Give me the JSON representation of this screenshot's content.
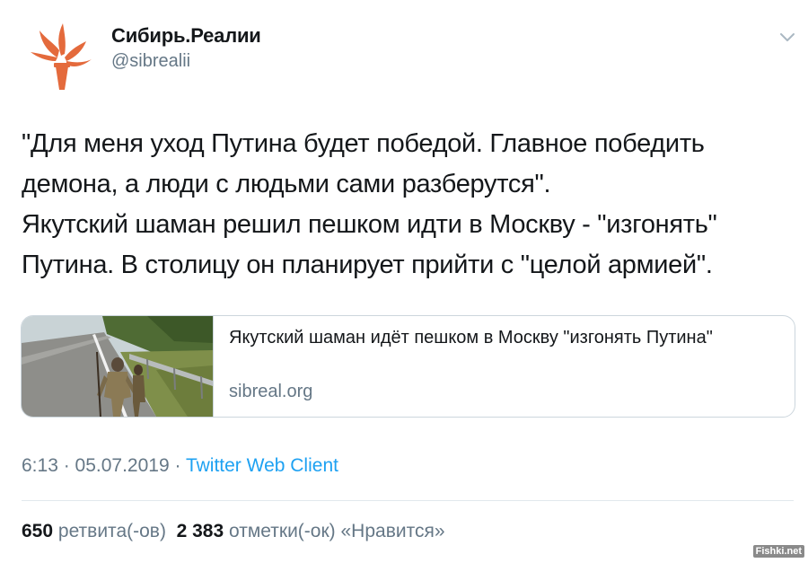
{
  "account": {
    "name": "Сибирь.Реалии",
    "handle": "@sibrealii",
    "logo_color": "#e46a3c"
  },
  "tweet": {
    "lines": [
      "\"Для меня уход Путина будет победой. Главное победить",
      "демона, а люди с людьми сами разберутся\".",
      "Якутский шаман решил пешком идти в Москву - \"изгонять\"",
      "Путина. В столицу он планирует прийти с \"целой армией\"."
    ]
  },
  "card": {
    "title": "Якутский шаман идёт пешком в Москву \"изгонять Путина\"",
    "domain": "sibreal.org",
    "image_icon": "photo-thumbnail"
  },
  "meta": {
    "time": "6:13",
    "separator1": " · ",
    "date": "05.07.2019",
    "separator2": " · ",
    "client": "Twitter Web Client"
  },
  "stats": {
    "retweets_count": "650",
    "retweets_label": "ретвита(-ов)",
    "likes_count": "2 383",
    "likes_label": "отметки(-ок) «Нравится»"
  },
  "watermark": "Fishki.net",
  "colors": {
    "text": "#14171a",
    "secondary": "#657786",
    "link": "#1da1f2",
    "border": "#ccd6dd"
  }
}
